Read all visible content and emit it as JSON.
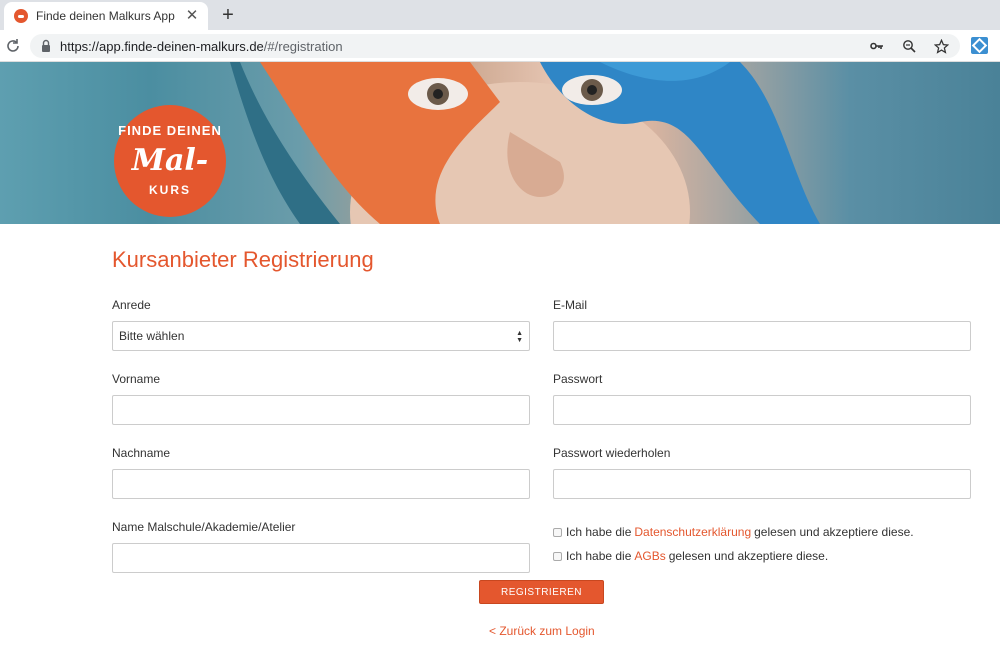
{
  "browser": {
    "tab_title": "Finde deinen Malkurs App",
    "close_glyph": "✕",
    "new_tab_glyph": "+",
    "url_main": "https://app.finde-deinen-malkurs.de",
    "url_rest": "/#/registration"
  },
  "logo": {
    "line1": "FINDE DEINEN",
    "line2": "Mal-",
    "line3": "KURS"
  },
  "form": {
    "title": "Kursanbieter Registrierung",
    "anrede_label": "Anrede",
    "anrede_value": "Bitte wählen",
    "vorname_label": "Vorname",
    "nachname_label": "Nachname",
    "school_label": "Name Malschule/Akademie/Atelier",
    "email_label": "E-Mail",
    "password_label": "Passwort",
    "password_repeat_label": "Passwort wiederholen",
    "privacy": {
      "prefix": "Ich habe die",
      "link": "Datenschutzerklärung",
      "suffix": "gelesen und akzeptiere diese."
    },
    "terms": {
      "prefix": "Ich habe die",
      "link": "AGBs",
      "suffix": "gelesen und akzeptiere diese."
    },
    "submit_label": "REGISTRIEREN",
    "back_link": "< Zurück zum Login"
  },
  "colors": {
    "accent": "#e4572e"
  }
}
